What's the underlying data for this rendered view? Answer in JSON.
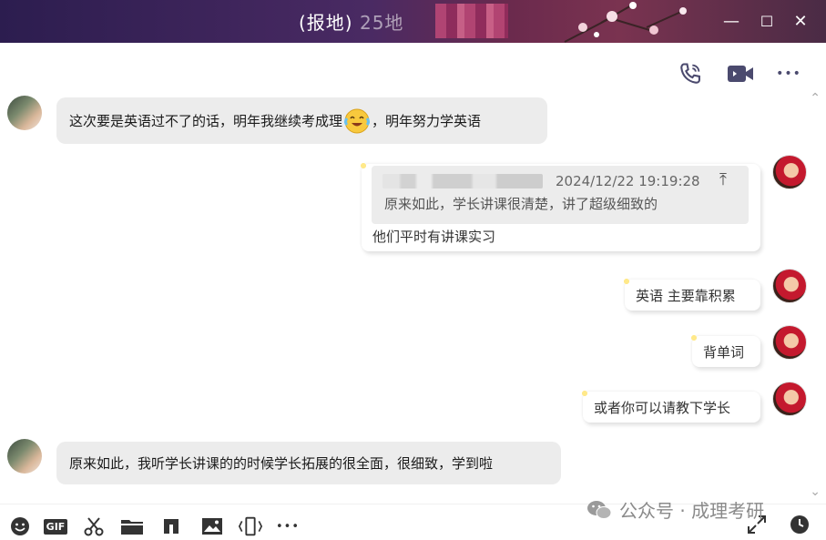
{
  "window": {
    "title_visible": "(报地)",
    "title_suffix": "25地",
    "minimize_symbol": "—",
    "maximize_symbol": "☐",
    "close_symbol": "✕"
  },
  "header_actions": [
    {
      "name": "voice-call",
      "icon": "phone-icon"
    },
    {
      "name": "video-call",
      "icon": "video-camera-icon"
    },
    {
      "name": "more",
      "icon": "more-dots-icon",
      "symbol": "•••"
    }
  ],
  "messages": {
    "m1": {
      "direction": "incoming",
      "text": "这次要是英语过不了的话，明年我继续考成理",
      "text_tail": "，明年努力学英语",
      "emoji": "crying-laughing-emoji"
    },
    "m2": {
      "direction": "outgoing",
      "quote": {
        "time": "2024/12/22 19:19:28",
        "text": "原来如此，学长讲课很清楚，讲了超级细致的",
        "jump_symbol": "⤒"
      },
      "text": "他们平时有讲课实习"
    },
    "m3": {
      "direction": "outgoing",
      "text": "英语 主要靠积累"
    },
    "m4": {
      "direction": "outgoing",
      "text": "背单词"
    },
    "m5": {
      "direction": "outgoing",
      "text": "或者你可以请教下学长"
    },
    "m6": {
      "direction": "incoming",
      "text": "原来如此，我听学长讲课的的时候学长拓展的很全面，很细致，学到啦"
    }
  },
  "scroll": {
    "up_symbol": "⌃",
    "down_symbol": "⌄"
  },
  "toolbar": {
    "items": [
      "emoji-icon",
      "gif-icon",
      "scissors-icon",
      "folder-icon",
      "music-note-icon",
      "image-icon",
      "shake-icon",
      "more-dots-icon"
    ],
    "gif_label": "GIF",
    "more_symbol": "•••"
  },
  "watermark": {
    "text": "公众号 · 成理考研"
  },
  "colors": {
    "titlebar_start": "#2c1d4f",
    "titlebar_end": "#7a3350",
    "icon_accent": "#4b4a6e",
    "incoming_bubble": "#ececec",
    "outgoing_bubble": "#ffffff"
  }
}
